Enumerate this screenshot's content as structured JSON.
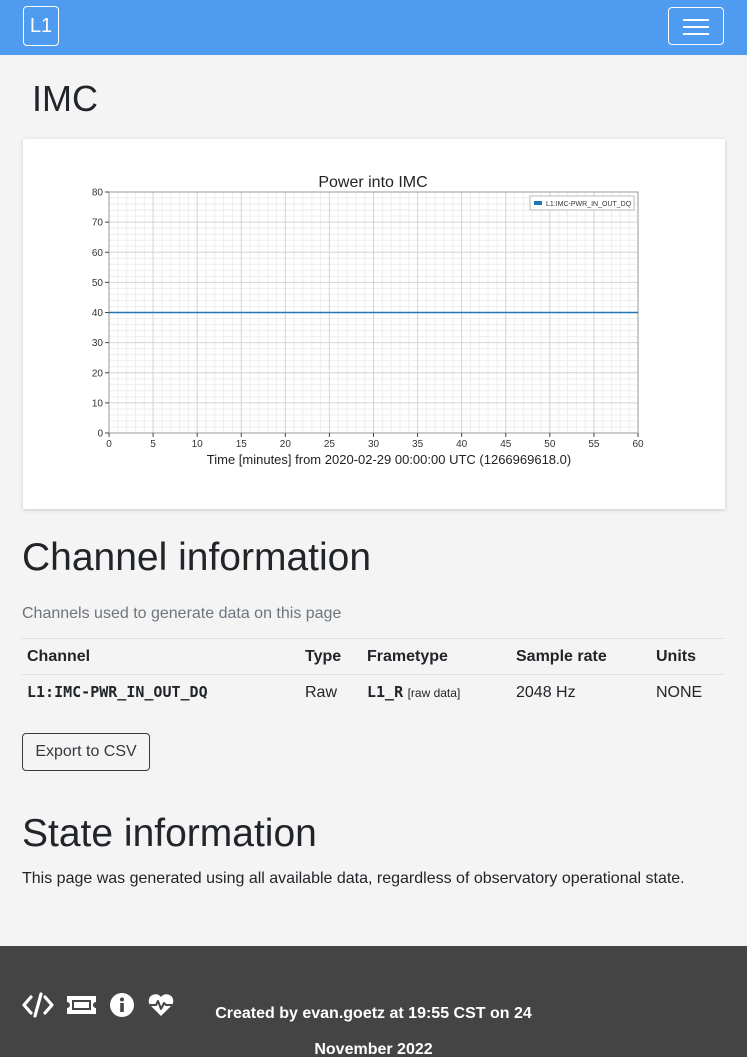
{
  "navbar": {
    "brand": "L1"
  },
  "page": {
    "title": "IMC"
  },
  "chart_data": {
    "type": "line",
    "title": "Power into IMC",
    "xlabel": "Time [minutes] from 2020-02-29 00:00:00 UTC (1266969618.0)",
    "ylabel": "",
    "xlim": [
      0,
      60
    ],
    "ylim": [
      0,
      80
    ],
    "xticks": [
      0,
      5,
      10,
      15,
      20,
      25,
      30,
      35,
      40,
      45,
      50,
      55,
      60
    ],
    "yticks": [
      0,
      10,
      20,
      30,
      40,
      50,
      60,
      70,
      80
    ],
    "grid": true,
    "legend_position": "top-right",
    "series": [
      {
        "name": "L1:IMC-PWR_IN_OUT_DQ",
        "color": "#1f77b4",
        "x": [
          0,
          60
        ],
        "y": [
          40,
          40
        ]
      }
    ]
  },
  "channel_section": {
    "heading": "Channel information",
    "description": "Channels used to generate data on this page",
    "headers": [
      "Channel",
      "Type",
      "Frametype",
      "Sample rate",
      "Units"
    ],
    "rows": [
      {
        "channel": "L1:IMC-PWR_IN_OUT_DQ",
        "type": "Raw",
        "frametype": "L1_R",
        "frametype_note": "[raw data]",
        "sample_rate": "2048 Hz",
        "units": "NONE"
      }
    ],
    "export_label": "Export to CSV"
  },
  "state_section": {
    "heading": "State information",
    "text": "This page was generated using all available data, regardless of observatory operational state."
  },
  "footer": {
    "credit_line1": "Created by evan.goetz at 19:55 CST on 24",
    "credit_line2": "November 2022",
    "icons": [
      "code-icon",
      "ticket-icon",
      "info-icon",
      "heartbeat-icon"
    ]
  }
}
